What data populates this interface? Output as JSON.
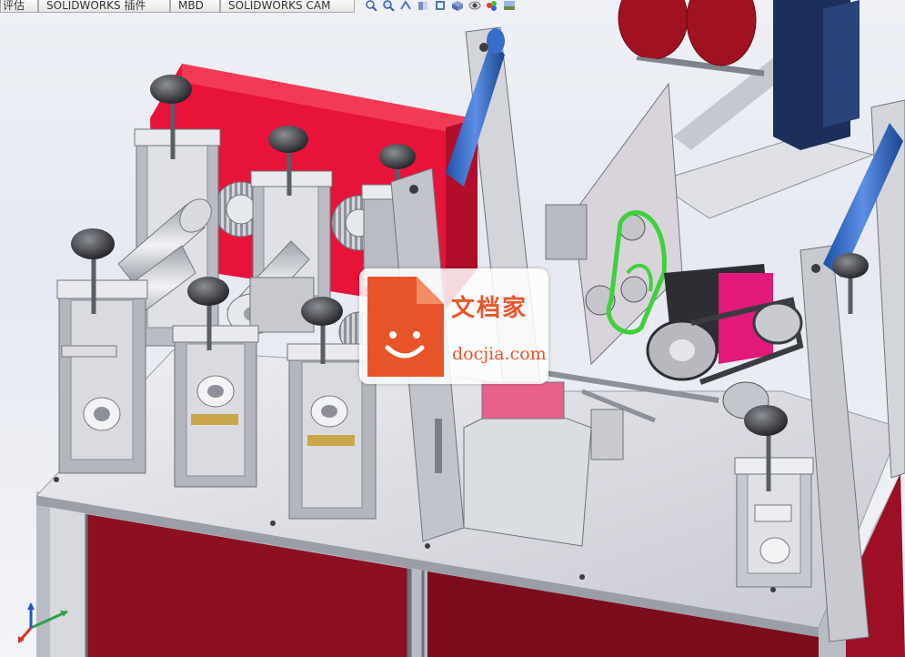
{
  "tabs": [
    {
      "label": "评估"
    },
    {
      "label": "SOLIDWORKS 插件"
    },
    {
      "label": "MBD"
    },
    {
      "label": "SOLIDWORKS CAM"
    }
  ],
  "toolbar_icons": [
    "zoom-fit-icon",
    "zoom-area-icon",
    "previous-view-icon",
    "section-view-icon",
    "view-orientation-icon",
    "display-style-icon",
    "hide-show-icon",
    "appearance-icon",
    "scene-icon"
  ],
  "watermark": {
    "name": "文档家",
    "url": "docjia.com",
    "accent": "#e8542a"
  },
  "colors": {
    "frame_red": "#e8133a",
    "cabinet_red": "#8c0f22",
    "steel": "#c9ccd3",
    "roller_blue": "#2f68c8",
    "belt_green": "#3fd13a",
    "magenta": "#e0197a",
    "navy": "#1b2f5a"
  }
}
